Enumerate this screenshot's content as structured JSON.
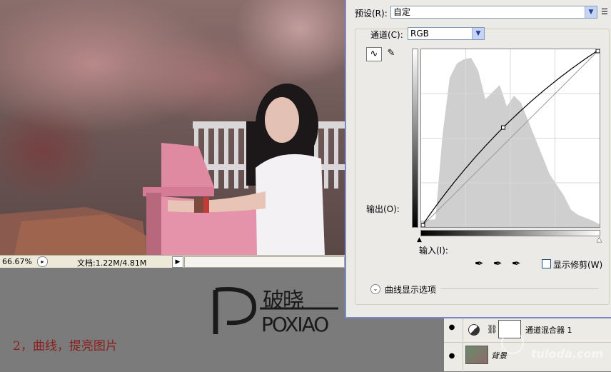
{
  "dialog": {
    "preset_label": "预设(R):",
    "preset_value": "自定",
    "channel_label": "通道(C):",
    "channel_value": "RGB",
    "output_label": "输出(O):",
    "input_label": "输入(I):",
    "show_clipping_label": "显示修剪(W)",
    "show_clipping_checked": false,
    "curve_options_label": "曲线显示选项",
    "curve_points": [
      [
        0,
        0
      ],
      [
        0.46,
        0.56
      ],
      [
        1,
        1
      ]
    ]
  },
  "status_bar": {
    "zoom": "66.67%",
    "doc_info": "文档:1.22M/4.81M"
  },
  "layers": [
    {
      "name": "通道混合器 1",
      "visible": true
    },
    {
      "name": "背景",
      "visible": true
    }
  ],
  "logo": {
    "cn_text": "破晓",
    "en_text": "POXIAO"
  },
  "caption": "2，曲线，提亮图片",
  "watermark": "tuloda.com"
}
